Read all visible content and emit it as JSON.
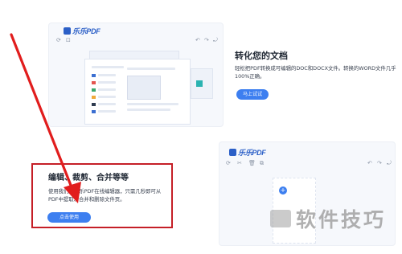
{
  "card1": {
    "logo": "乐乐PDF",
    "toolbar_icons": [
      "refresh-icon",
      "fit-icon",
      "undo-icon",
      "redo-icon",
      "rotate-icon"
    ],
    "title": "转化您的文档",
    "description": "轻松把PDF转换成可编辑的DOC和DOCX文件。转换的WORD文件几乎100%正确。",
    "button": "马上试试"
  },
  "card2": {
    "logo": "乐乐PDF",
    "title": "编辑、裁剪、合并等等",
    "description": "使用我们的乐乐PDF在线编辑器，只需几秒即可从PDF中提取、合并和删除文件页。",
    "button": "点击使用",
    "plus": "+"
  },
  "watermark": {
    "text": "软件技巧"
  },
  "colors": {
    "accent": "#3d7ff0",
    "highlight_box": "#c51f27",
    "arrow": "#e11d1d"
  }
}
